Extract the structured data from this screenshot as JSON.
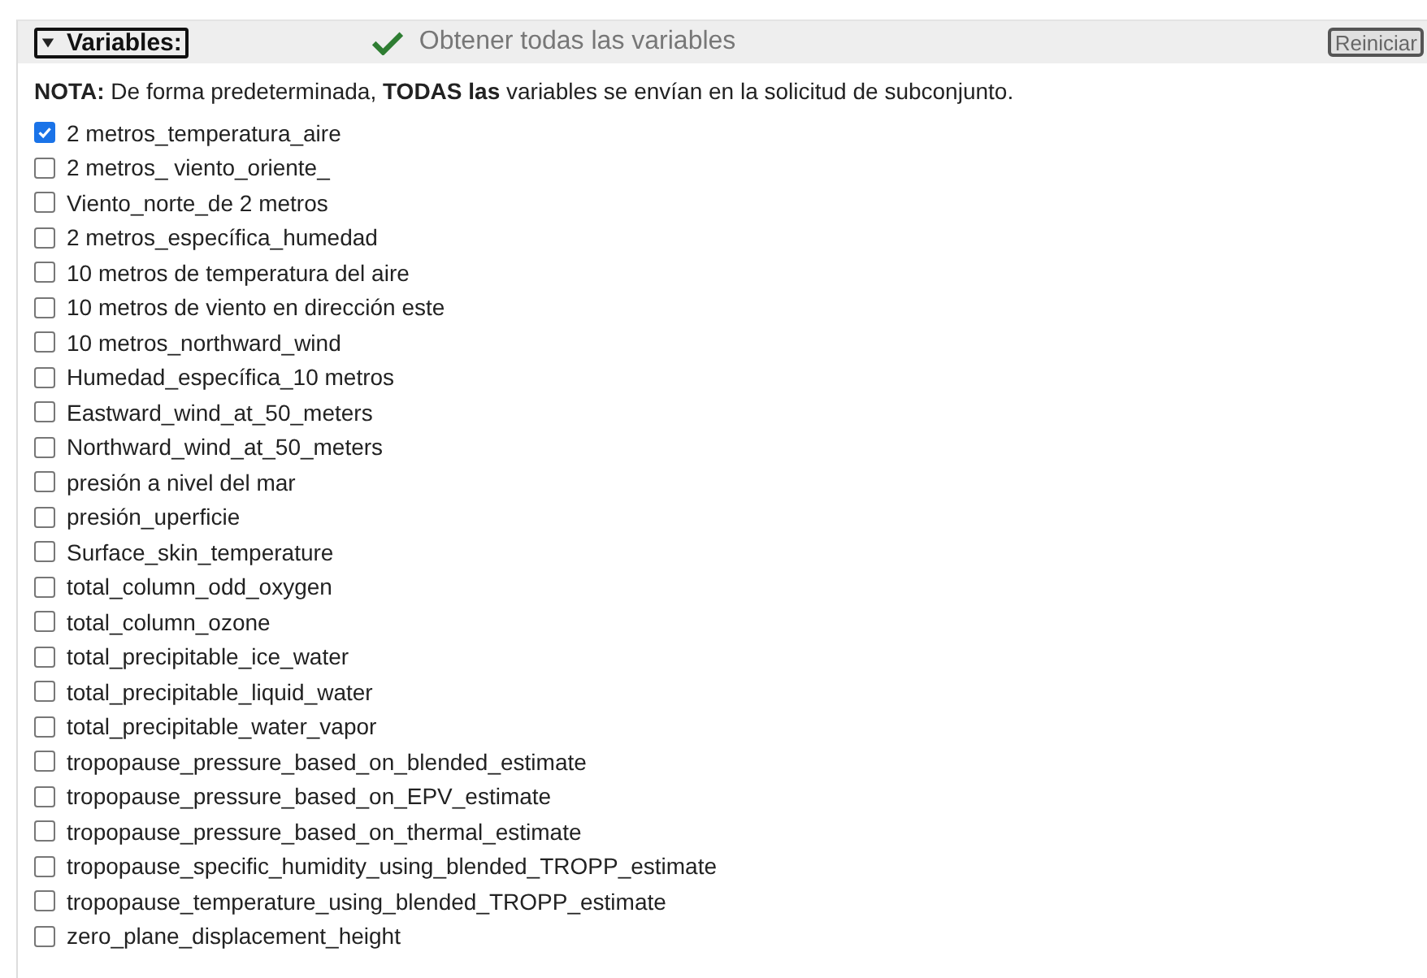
{
  "section": {
    "title": "Variables:",
    "expanded": true,
    "status": "Obtener todas las variables",
    "reset_button": "Reiniciar"
  },
  "note": "**NOTA:** De forma predeterminada, **TODAS las** variables se envían en la solicitud de subconjunto.",
  "variables": [
    {
      "label": "2 metros_temperatura_aire",
      "checked": true
    },
    {
      "label": "2 metros_ viento_oriente_",
      "checked": false
    },
    {
      "label": "Viento_norte_de 2 metros",
      "checked": false
    },
    {
      "label": "2 metros_específica_humedad",
      "checked": false
    },
    {
      "label": "10 metros de temperatura del aire",
      "checked": false
    },
    {
      "label": "10 metros de viento en dirección este",
      "checked": false
    },
    {
      "label": "10 metros_northward_wind",
      "checked": false
    },
    {
      "label": "Humedad_específica_10 metros",
      "checked": false
    },
    {
      "label": "Eastward_wind_at_50_meters",
      "checked": false
    },
    {
      "label": "Northward_wind_at_50_meters",
      "checked": false
    },
    {
      "label": "presión a nivel del mar",
      "checked": false
    },
    {
      "label": "presión_uperficie",
      "checked": false
    },
    {
      "label": "Surface_skin_temperature",
      "checked": false
    },
    {
      "label": "total_column_odd_oxygen",
      "checked": false
    },
    {
      "label": "total_column_ozone",
      "checked": false
    },
    {
      "label": "total_precipitable_ice_water",
      "checked": false
    },
    {
      "label": "total_precipitable_liquid_water",
      "checked": false
    },
    {
      "label": "total_precipitable_water_vapor",
      "checked": false
    },
    {
      "label": "tropopause_pressure_based_on_blended_estimate",
      "checked": false
    },
    {
      "label": "tropopause_pressure_based_on_EPV_estimate",
      "checked": false
    },
    {
      "label": "tropopause_pressure_based_on_thermal_estimate",
      "checked": false
    },
    {
      "label": "tropopause_specific_humidity_using_blended_TROPP_estimate",
      "checked": false
    },
    {
      "label": "tropopause_temperature_using_blended_TROPP_estimate",
      "checked": false
    },
    {
      "label": "zero_plane_displacement_height",
      "checked": false
    }
  ]
}
